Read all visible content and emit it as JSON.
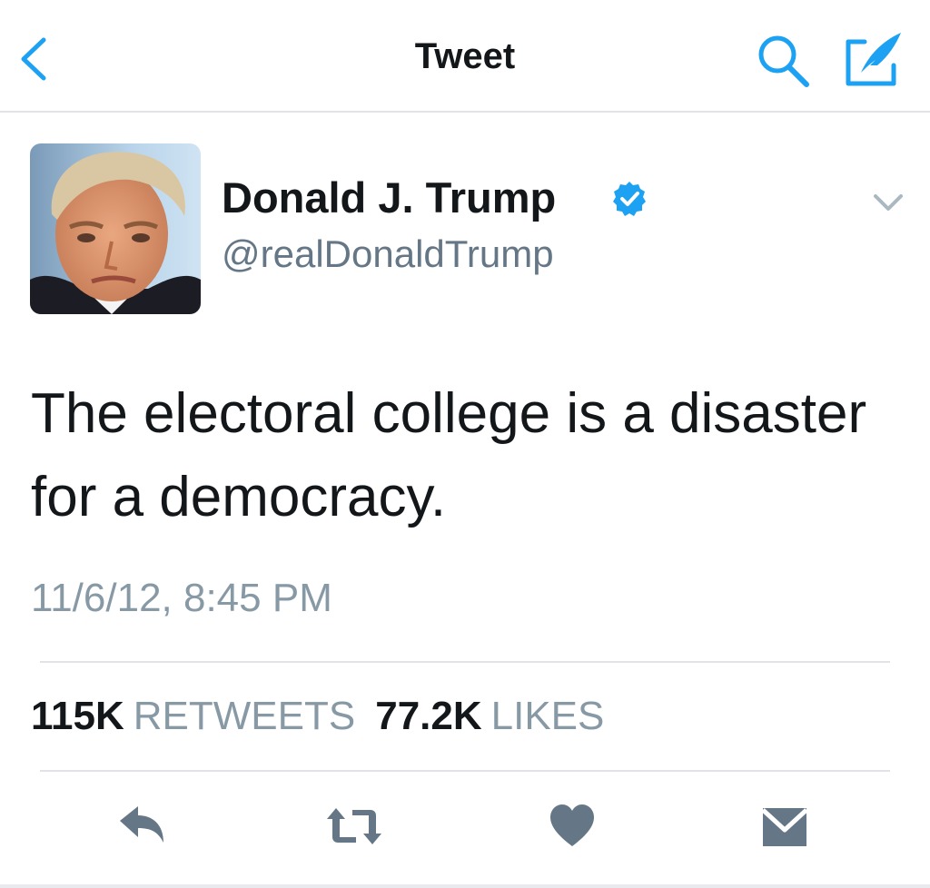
{
  "nav": {
    "title": "Tweet",
    "back_icon": "chevron-left-icon",
    "search_icon": "search-icon",
    "compose_icon": "compose-tweet-icon",
    "accent_color": "#1da1f2"
  },
  "author": {
    "display_name": "Donald J. Trump",
    "handle": "@realDonaldTrump",
    "verified": true,
    "verified_icon": "verified-badge-icon",
    "menu_icon": "chevron-down-icon"
  },
  "tweet": {
    "text": "The electoral college is a disaster for a democracy.",
    "timestamp": "11/6/12, 8:45 PM"
  },
  "stats": {
    "retweets_count": "115K",
    "retweets_label": "RETWEETS",
    "likes_count": "77.2K",
    "likes_label": "LIKES"
  },
  "actions": [
    {
      "name": "reply",
      "icon": "reply-icon"
    },
    {
      "name": "retweet",
      "icon": "retweet-icon"
    },
    {
      "name": "like",
      "icon": "heart-icon"
    },
    {
      "name": "direct-message",
      "icon": "envelope-icon"
    }
  ],
  "colors": {
    "accent": "#1da1f2",
    "text_primary": "#14171a",
    "text_secondary": "#657786",
    "action_gray": "#657786"
  }
}
